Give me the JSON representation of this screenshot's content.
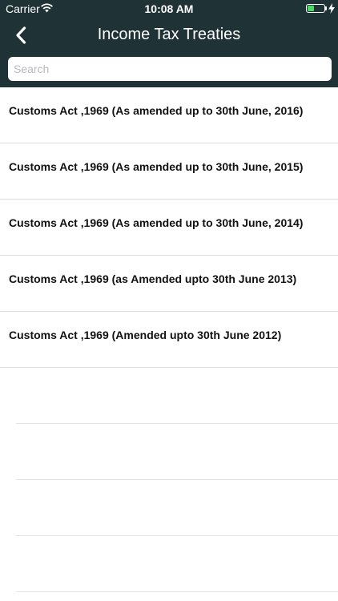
{
  "status_bar": {
    "carrier": "Carrier",
    "time": "10:08 AM",
    "battery_level_percent": 45,
    "battery_color": "#4cd964"
  },
  "nav": {
    "title": "Income Tax Treaties",
    "back_icon": "chevron-left-icon",
    "background_color": "#1f3236"
  },
  "search": {
    "placeholder": "Search",
    "value": ""
  },
  "items": [
    {
      "label": "Customs Act ,1969 (As amended up to 30th June, 2016)"
    },
    {
      "label": "Customs Act ,1969 (As amended up to 30th June, 2015)"
    },
    {
      "label": "Customs Act ,1969 (As amended up to 30th June, 2014)"
    },
    {
      "label": "Customs Act ,1969 (as Amended upto 30th June 2013)"
    },
    {
      "label": "Customs Act ,1969 (Amended upto 30th June 2012)"
    }
  ]
}
